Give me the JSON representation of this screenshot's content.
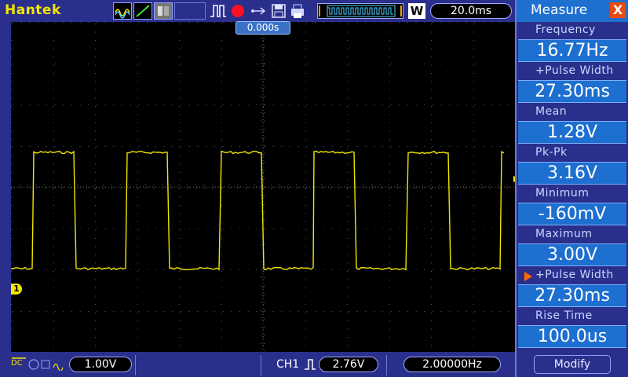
{
  "brand": "Hantek",
  "toolbar": {
    "trigger_icon": "trigger-edge-icon",
    "acquire_mode": "W",
    "timebase": "20.0ms"
  },
  "screen": {
    "trigger_position": "0.000s",
    "ch1_marker": "1",
    "trace_color": "#f2e600",
    "grid_color": "#555555"
  },
  "measure": {
    "title": "Measure",
    "close_label": "X",
    "items": [
      {
        "label": "Frequency",
        "value": "16.77Hz"
      },
      {
        "label": "+Pulse Width",
        "value": "27.30ms"
      },
      {
        "label": "Mean",
        "value": "1.28V"
      },
      {
        "label": "Pk-Pk",
        "value": "3.16V"
      },
      {
        "label": "Minimum",
        "value": "-160mV"
      },
      {
        "label": "Maximum",
        "value": "3.00V"
      },
      {
        "label": "+Pulse Width",
        "value": "27.30ms"
      },
      {
        "label": "Rise Time",
        "value": "100.0us"
      }
    ],
    "modify_label": "Modify"
  },
  "bottom": {
    "ch1_coupling": "DC",
    "ch1_volts_div": "1.00V",
    "trigger_source": "CH1",
    "trigger_level": "2.76V",
    "trigger_frequency": "2.00000Hz"
  }
}
